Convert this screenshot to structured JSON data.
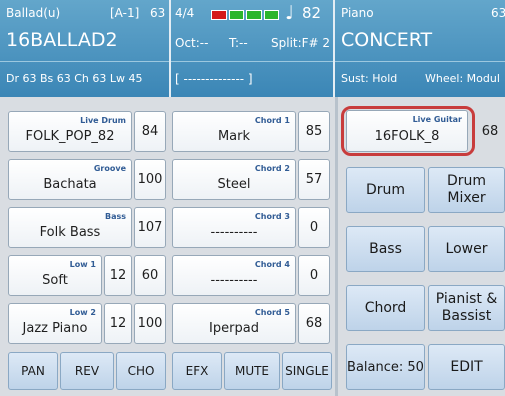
{
  "header": {
    "style_panel": {
      "line1_left": "Ballad(u)",
      "line1_bank": "[A-1]",
      "line1_num": "63",
      "name": "16BALLAD2",
      "line3": "Dr 63  Bs 63  Ch 63  Lw 45"
    },
    "mid_panel": {
      "time_sig": "4/4",
      "tempo": "82",
      "oct": "Oct:--",
      "t": "T:--",
      "split": "Split:F# 2",
      "chord_field": "[ -------------- ]",
      "beat_colors": [
        "#d41a1a",
        "#2bb52b",
        "#2bb52b",
        "#2bb52b"
      ]
    },
    "voice_panel": {
      "line1": "Piano",
      "line1_num": "63",
      "name": "CONCERT",
      "sust": "Sust: Hold",
      "wheel": "Wheel: Modul"
    }
  },
  "left_grid": {
    "rows": [
      {
        "a": {
          "category": "Live Drum",
          "label": "FOLK_POP_82",
          "value": "84"
        },
        "b": {
          "category": "Chord 1",
          "label": "Mark",
          "value": "85"
        }
      },
      {
        "a": {
          "category": "Groove",
          "label": "Bachata",
          "value": "100"
        },
        "b": {
          "category": "Chord 2",
          "label": "Steel",
          "value": "57"
        }
      },
      {
        "a": {
          "category": "Bass",
          "label": "Folk Bass",
          "value": "107"
        },
        "b": {
          "category": "Chord 3",
          "label": "----------",
          "value": "0"
        }
      },
      {
        "a": {
          "category": "Low 1",
          "label": "Soft",
          "extra": "12",
          "value": "60"
        },
        "b": {
          "category": "Chord 4",
          "label": "----------",
          "value": "0"
        }
      },
      {
        "a": {
          "category": "Low 2",
          "label": "Jazz Piano",
          "extra": "12",
          "value": "100"
        },
        "b": {
          "category": "Chord 5",
          "label": "Iperpad",
          "value": "68"
        }
      }
    ]
  },
  "right_panel": {
    "live_guitar": {
      "category": "Live Guitar",
      "label": "16FOLK_8",
      "value": "68"
    },
    "buttons": [
      "Drum",
      "Drum\nMixer",
      "Bass",
      "Lower",
      "Chord",
      "Pianist &\nBassist"
    ],
    "balance": "Balance: 50",
    "edit": "EDIT"
  },
  "bottom_bar": [
    "PAN",
    "REV",
    "CHO",
    "EFX",
    "MUTE",
    "SINGLE"
  ],
  "colors": {
    "header_blue": "#3b86b6",
    "highlight_ring": "#c83c3c"
  }
}
